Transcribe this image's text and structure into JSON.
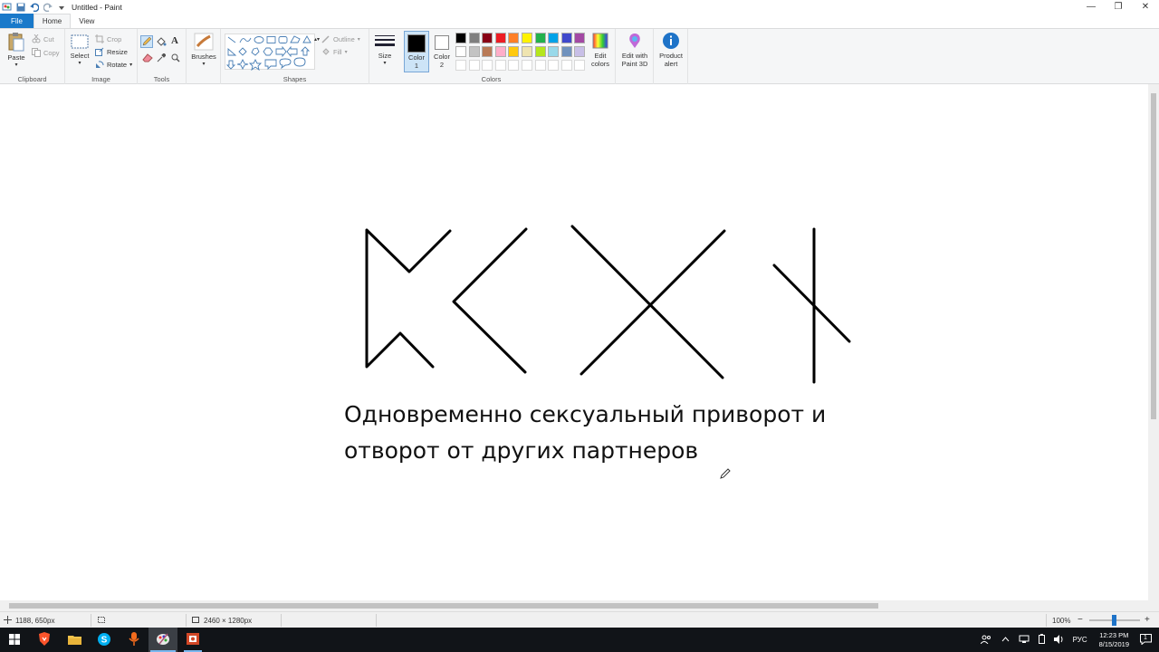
{
  "window": {
    "title": "Untitled - Paint"
  },
  "tabs": [
    {
      "label": "File"
    },
    {
      "label": "Home"
    },
    {
      "label": "View"
    }
  ],
  "ribbon": {
    "clipboard": {
      "group_label": "Clipboard",
      "paste": "Paste",
      "cut": "Cut",
      "copy": "Copy"
    },
    "image": {
      "group_label": "Image",
      "select": "Select",
      "crop": "Crop",
      "resize": "Resize",
      "rotate": "Rotate"
    },
    "tools": {
      "group_label": "Tools"
    },
    "brushes": {
      "label": "Brushes"
    },
    "shapes": {
      "group_label": "Shapes",
      "outline": "Outline",
      "fill": "Fill"
    },
    "size": {
      "label": "Size"
    },
    "color1": {
      "label": "Color",
      "sub": "1"
    },
    "color2": {
      "label": "Color",
      "sub": "2"
    },
    "colors": {
      "group_label": "Colors",
      "row1": [
        "#000000",
        "#7f7f7f",
        "#880015",
        "#ed1c24",
        "#ff7f27",
        "#fff200",
        "#22b14c",
        "#00a2e8",
        "#3f48cc",
        "#a349a4"
      ],
      "row2": [
        "#ffffff",
        "#c3c3c3",
        "#b97a57",
        "#ffaec9",
        "#ffc90e",
        "#efe4b0",
        "#b5e61d",
        "#99d9ea",
        "#7092be",
        "#c8bfe7"
      ],
      "row3": [
        "#ffffff",
        "#ffffff",
        "#ffffff",
        "#ffffff",
        "#ffffff",
        "#ffffff",
        "#ffffff",
        "#ffffff",
        "#ffffff",
        "#ffffff"
      ]
    },
    "edit_colors": {
      "line1": "Edit",
      "line2": "colors"
    },
    "paint3d": {
      "line1": "Edit with",
      "line2": "Paint 3D"
    },
    "product_alert": {
      "line1": "Product",
      "line2": "alert"
    }
  },
  "canvas": {
    "text_line1": "Одновременно сексуальный приворот и",
    "text_line2": "отворот от других партнеров"
  },
  "statusbar": {
    "cursor_pos": "1188, 650px",
    "image_size": "2460 × 1280px",
    "zoom": "100%"
  },
  "taskbar": {
    "lang": "РУС",
    "time": "12:23 PM",
    "date": "8/15/2019",
    "notification_count": "1"
  }
}
